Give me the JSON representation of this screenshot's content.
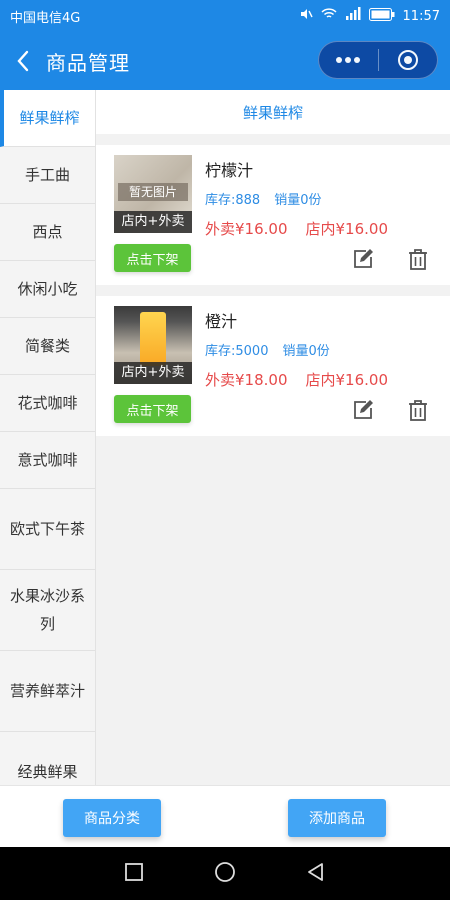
{
  "statusbar": {
    "carrier": "中国电信4G",
    "time": "11:57"
  },
  "navbar": {
    "title": "商品管理"
  },
  "sidebar": {
    "items": [
      {
        "label": "鲜果鲜榨"
      },
      {
        "label": "手工曲"
      },
      {
        "label": "西点"
      },
      {
        "label": "休闲小吃"
      },
      {
        "label": "简餐类"
      },
      {
        "label": "花式咖啡"
      },
      {
        "label": "意式咖啡"
      },
      {
        "label": "欧式下午茶"
      },
      {
        "label": "水果冰沙系列"
      },
      {
        "label": "营养鲜萃汁"
      },
      {
        "label": "经典鲜果"
      }
    ]
  },
  "main": {
    "title": "鲜果鲜榨",
    "products": [
      {
        "name": "柠檬汁",
        "image_text": "暂无图片",
        "tag": "店内+外卖",
        "stock": "库存:888",
        "sales": "销量0份",
        "takeout_price": "外卖¥16.00",
        "instore_price": "店内¥16.00",
        "off_shelf_label": "点击下架"
      },
      {
        "name": "橙汁",
        "tag": "店内+外卖",
        "stock": "库存:5000",
        "sales": "销量0份",
        "takeout_price": "外卖¥18.00",
        "instore_price": "店内¥16.00",
        "off_shelf_label": "点击下架"
      }
    ]
  },
  "bottom": {
    "category_label": "商品分类",
    "add_label": "添加商品"
  },
  "colors": {
    "primary": "#1e88e5",
    "green": "#5cc43a",
    "price_red": "#e64a4a",
    "button_blue": "#42a5f5"
  }
}
